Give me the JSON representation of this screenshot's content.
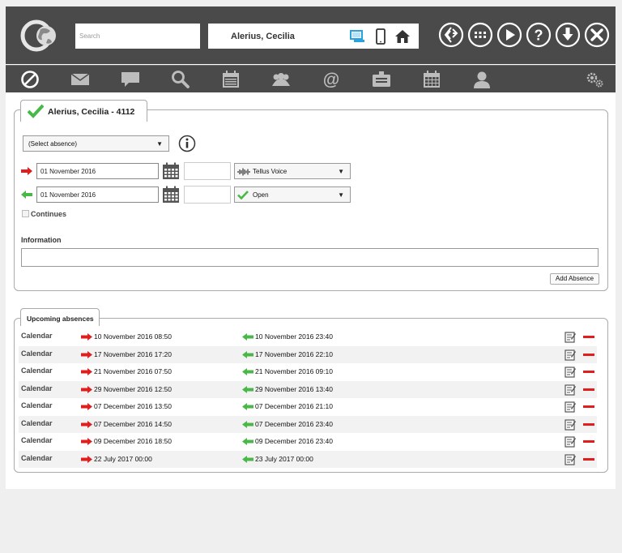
{
  "header": {
    "search_placeholder": "Search",
    "user_name": "Alerius, Cecilia",
    "device_icons": [
      "desktop-icon",
      "mobile-icon",
      "home-icon"
    ],
    "action_icons": [
      "switch-icon",
      "apps-grid-icon",
      "play-icon",
      "help-icon",
      "download-icon",
      "close-icon"
    ]
  },
  "nav": {
    "icons": [
      "absence-icon",
      "mail-icon",
      "chat-icon",
      "search-icon",
      "calendar-list-icon",
      "group-icon",
      "at-icon",
      "inbox-icon",
      "calendar-icon",
      "person-icon",
      "settings-icon"
    ]
  },
  "form": {
    "tab_title": "Alerius, Cecilia - 4112",
    "absence_select": "(Select absence)",
    "start_date": "01 November  2016",
    "end_date": "01 November  2016",
    "start_channel": "Tellus Voice",
    "end_status": "Open",
    "continues_label": "Continues",
    "information_label": "Information",
    "information_value": "",
    "add_button": "Add Absence"
  },
  "upcoming": {
    "tab_title": "Upcoming absences",
    "rows": [
      {
        "source": "Calendar",
        "start": "10 November 2016 08:50",
        "end": "10 November 2016 23:40"
      },
      {
        "source": "Calendar",
        "start": "17 November 2016 17:20",
        "end": "17 November 2016 22:10"
      },
      {
        "source": "Calendar",
        "start": "21 November 2016 07:50",
        "end": "21 November 2016 09:10"
      },
      {
        "source": "Calendar",
        "start": "29 November 2016 12:50",
        "end": "29 November 2016 13:40"
      },
      {
        "source": "Calendar",
        "start": "07 December 2016 13:50",
        "end": "07 December 2016 21:10"
      },
      {
        "source": "Calendar",
        "start": "07 December 2016 14:50",
        "end": "07 December 2016 23:40"
      },
      {
        "source": "Calendar",
        "start": "09 December 2016 18:50",
        "end": "09 December 2016 23:40"
      },
      {
        "source": "Calendar",
        "start": "22 July 2017 00:00",
        "end": "23 July 2017 00:00"
      }
    ]
  },
  "colors": {
    "bar_bg": "#4a4a4a",
    "accent_blue": "#29a3e0",
    "start_red": "#e01e1e",
    "end_green": "#49b848"
  }
}
